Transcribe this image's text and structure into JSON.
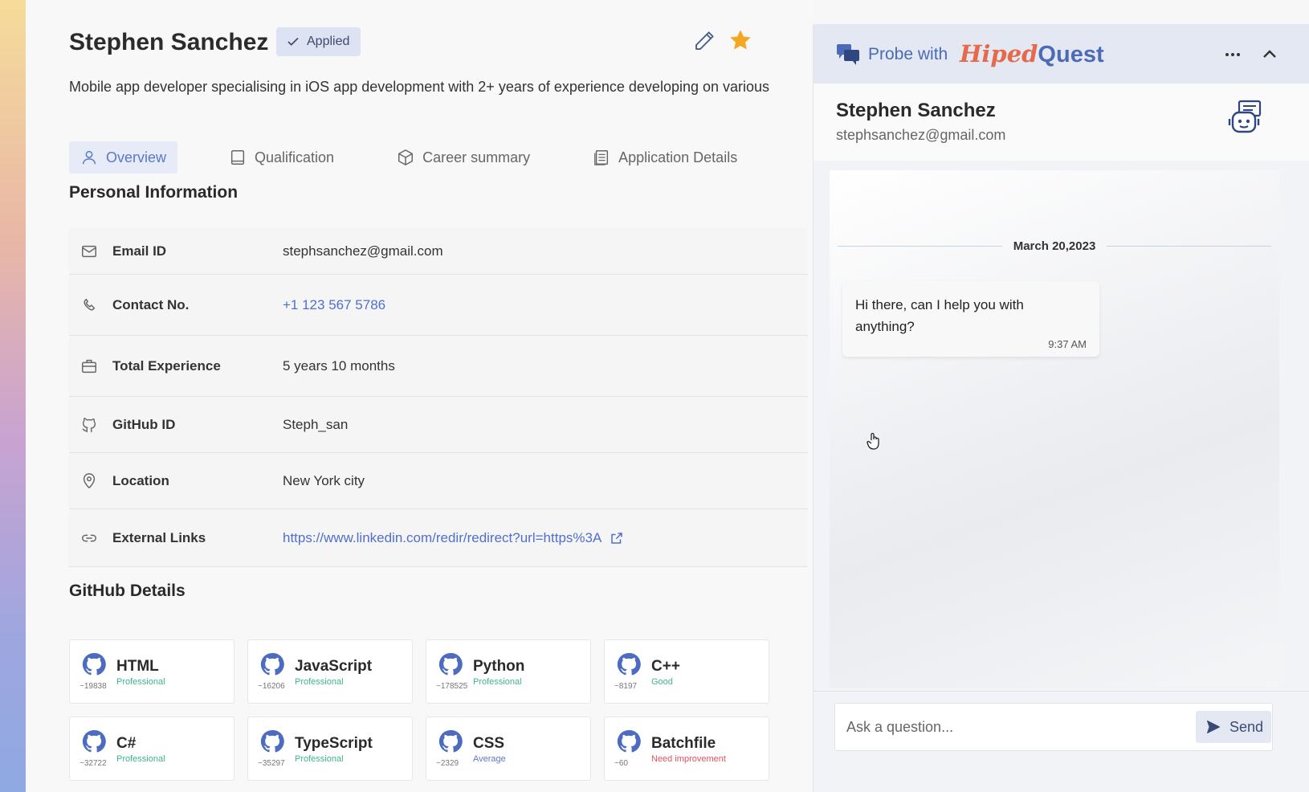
{
  "candidate": {
    "name": "Stephen Sanchez",
    "status": "Applied",
    "summary": "Mobile app developer specialising in iOS app development with 2+ years of experience developing on various"
  },
  "tabs": [
    {
      "label": "Overview",
      "icon": "user-icon",
      "active": true
    },
    {
      "label": "Qualification",
      "icon": "book-icon",
      "active": false
    },
    {
      "label": "Career summary",
      "icon": "box-icon",
      "active": false
    },
    {
      "label": "Application Details",
      "icon": "document-icon",
      "active": false
    }
  ],
  "personal": {
    "title": "Personal Information",
    "rows": [
      {
        "label": "Email ID",
        "value": "stephsanchez@gmail.com",
        "icon": "mail-icon"
      },
      {
        "label": "Contact No.",
        "value": "+1 123 567 5786",
        "icon": "phone-icon"
      },
      {
        "label": "Total Experience",
        "value": "5 years 10 months",
        "icon": "briefcase-icon"
      },
      {
        "label": "GitHub ID",
        "value": "Steph_san",
        "icon": "github-icon"
      },
      {
        "label": "Location",
        "value": "New York city",
        "icon": "location-pin-icon"
      },
      {
        "label": "External Links",
        "value": "https://www.linkedin.com/redir/redirect?url=https%3A",
        "icon": "link-icon"
      }
    ]
  },
  "github": {
    "title": "GitHub Details",
    "languages": [
      {
        "name": "HTML",
        "count": "~19838",
        "level": "Professional",
        "level_color": "#3fb58a"
      },
      {
        "name": "JavaScript",
        "count": "~16206",
        "level": "Professional",
        "level_color": "#3fb58a"
      },
      {
        "name": "Python",
        "count": "~178525",
        "level": "Professional",
        "level_color": "#3fb58a"
      },
      {
        "name": "C++",
        "count": "~8197",
        "level": "Good",
        "level_color": "#3fb58a"
      },
      {
        "name": "C#",
        "count": "~32722",
        "level": "Professional",
        "level_color": "#3fb58a"
      },
      {
        "name": "TypeScript",
        "count": "~35297",
        "level": "Professional",
        "level_color": "#3fb58a"
      },
      {
        "name": "CSS",
        "count": "~2329",
        "level": "Average",
        "level_color": "#5b78c8"
      },
      {
        "name": "Batchfile",
        "count": "~60",
        "level": "Need improvement",
        "level_color": "#e0535f"
      }
    ]
  },
  "chat": {
    "probe_label": "Probe with",
    "brand_part1": "Hiped",
    "brand_part2": "Quest",
    "contact_name": "Stephen Sanchez",
    "contact_email": "stephsanchez@gmail.com",
    "date": "March 20,2023",
    "message": {
      "text": "Hi there, can I help you with anything?",
      "time": "9:37 AM"
    },
    "input_placeholder": "Ask a question...",
    "send_label": "Send"
  },
  "colors": {
    "accent": "#5b78c8",
    "star": "#f5a623",
    "link": "#4f6fcf"
  }
}
